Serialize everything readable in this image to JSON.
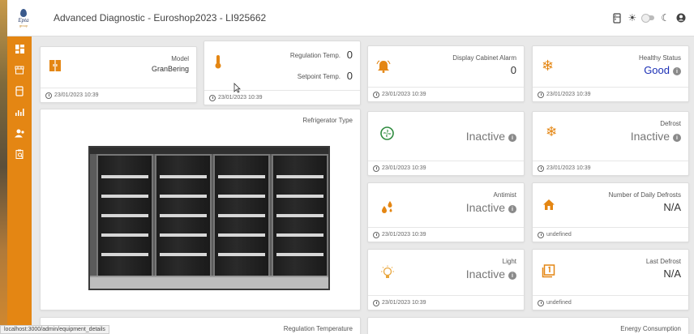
{
  "header": {
    "title": "Advanced Diagnostic - Euroshop2023 - LI925662",
    "logo_text": "Epta",
    "logo_sub": "group",
    "icons": [
      "fridge-icon",
      "sun-icon",
      "theme-toggle",
      "moon-icon",
      "user-icon"
    ]
  },
  "sidebar": {
    "items": [
      {
        "name": "dashboard-icon"
      },
      {
        "name": "store-icon"
      },
      {
        "name": "fridge-icon"
      },
      {
        "name": "chart-icon"
      },
      {
        "name": "users-icon"
      },
      {
        "name": "report-icon"
      }
    ]
  },
  "cards": {
    "model": {
      "label": "Model",
      "value": "GranBering",
      "timestamp": "23/01/2023 10:39"
    },
    "temps": {
      "regulation_label": "Regulation Temp.",
      "regulation_value": "0",
      "setpoint_label": "Setpoint Temp.",
      "setpoint_value": "0",
      "timestamp": "23/01/2023 10:39"
    },
    "alarm": {
      "label": "Display Cabinet Alarm",
      "value": "0",
      "timestamp": "23/01/2023 10:39"
    },
    "healthy": {
      "label": "Healthy Status",
      "value": "Good",
      "timestamp": "23/01/2023 10:39"
    },
    "fridge_type": {
      "label": "Refrigerator Type"
    },
    "fan": {
      "value": "Inactive",
      "timestamp": "23/01/2023 10:39"
    },
    "defrost": {
      "label": "Defrost",
      "value": "Inactive",
      "timestamp": "23/01/2023 10:39"
    },
    "antimist": {
      "label": "Antimist",
      "value": "Inactive",
      "timestamp": "23/01/2023 10:39"
    },
    "daily_defrosts": {
      "label": "Number of Daily Defrosts",
      "value": "N/A",
      "timestamp": "undefined"
    },
    "light": {
      "label": "Light",
      "value": "Inactive",
      "timestamp": "23/01/2023 10:39"
    },
    "last_defrost": {
      "label": "Last Defrost",
      "value": "N/A",
      "timestamp": "undefined"
    },
    "regulation_temperature": {
      "label": "Regulation Temperature"
    },
    "energy": {
      "label": "Energy Consumption"
    }
  },
  "status_bar": {
    "url": "localhost:3000/admin/equipment_details"
  },
  "colors": {
    "accent": "#e48613",
    "good": "#1b2fb5"
  }
}
